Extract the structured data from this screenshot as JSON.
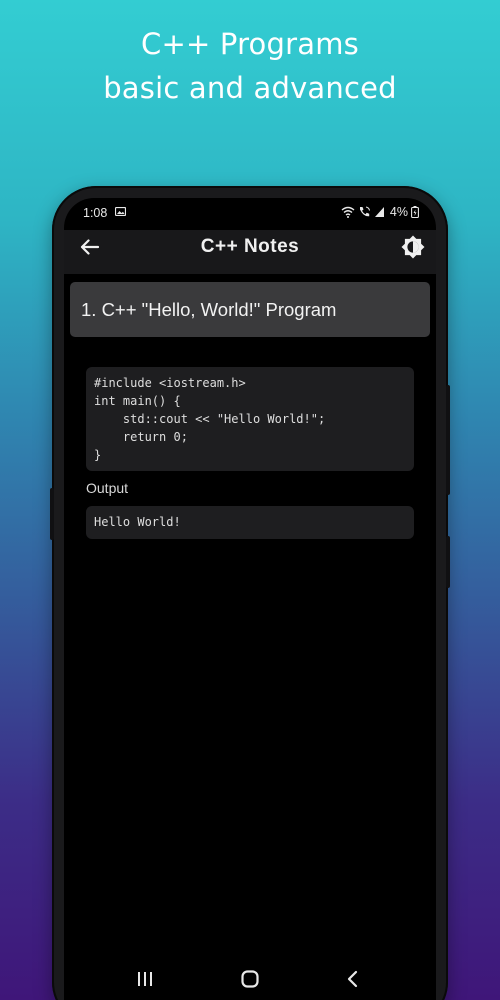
{
  "promo": {
    "line1": "C++ Programs",
    "line2": "basic and advanced"
  },
  "status_bar": {
    "time": "1:08",
    "battery": "4%",
    "icons": [
      "image-icon",
      "wifi-icon",
      "vowifi-call-icon",
      "signal-icon",
      "battery-icon"
    ]
  },
  "app_bar": {
    "title": "C++ Notes",
    "back_icon": "arrow-left-icon",
    "theme_icon": "brightness-icon"
  },
  "program": {
    "title": "1. C++ \"Hello, World!\" Program",
    "code": "#include <iostream.h>\nint main() {\n    std::cout << \"Hello World!\";\n    return 0;\n}",
    "output_label": "Output",
    "output": "Hello World!"
  },
  "nav_bar": {
    "icons": [
      "recents-icon",
      "home-icon",
      "back-icon"
    ]
  },
  "colors": {
    "gradient_top": "#33cdd2",
    "gradient_bottom": "#3f1679",
    "app_bar_bg": "#18181a",
    "card_bg": "#3a3a3c",
    "code_bg": "#1e1e20"
  }
}
